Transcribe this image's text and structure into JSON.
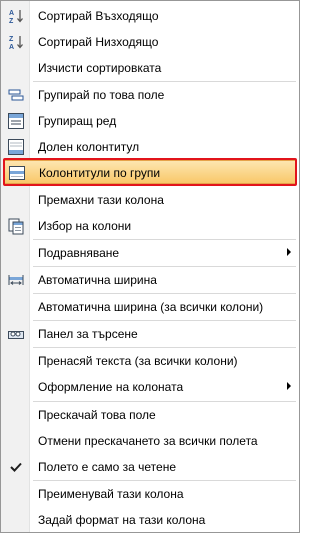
{
  "menu": {
    "items": [
      {
        "label": "Сортирай Възходящо",
        "icon": "sort-ascending-icon"
      },
      {
        "label": "Сортирай Низходящо",
        "icon": "sort-descending-icon"
      },
      {
        "label": "Изчисти сортировката"
      },
      {
        "label": "Групирай по това поле",
        "icon": "group-by-field-icon"
      },
      {
        "label": "Групиращ ред",
        "icon": "group-row-icon"
      },
      {
        "label": "Долен колонтитул",
        "icon": "footer-icon"
      },
      {
        "label": "Колонтитули по групи",
        "icon": "group-footers-icon",
        "highlighted": true
      },
      {
        "label": "Премахни тази колона"
      },
      {
        "label": "Избор на колони",
        "icon": "column-chooser-icon"
      },
      {
        "label": "Подравняване",
        "submenu": true
      },
      {
        "label": "Автоматична ширина",
        "icon": "best-fit-icon"
      },
      {
        "label": "Автоматична ширина (за всички колони)"
      },
      {
        "label": "Панел за търсене",
        "icon": "find-panel-icon"
      },
      {
        "label": "Пренасяй текста (за всички колони)"
      },
      {
        "label": "Оформление на колоната",
        "submenu": true
      },
      {
        "label": "Прескачай това поле"
      },
      {
        "label": "Отмени прескачането за всички полета"
      },
      {
        "label": "Полето е само за четене",
        "icon": "checkmark-icon",
        "checked": true
      },
      {
        "label": "Преименувай тази колона"
      },
      {
        "label": "Задай формат на тази колона"
      }
    ]
  }
}
